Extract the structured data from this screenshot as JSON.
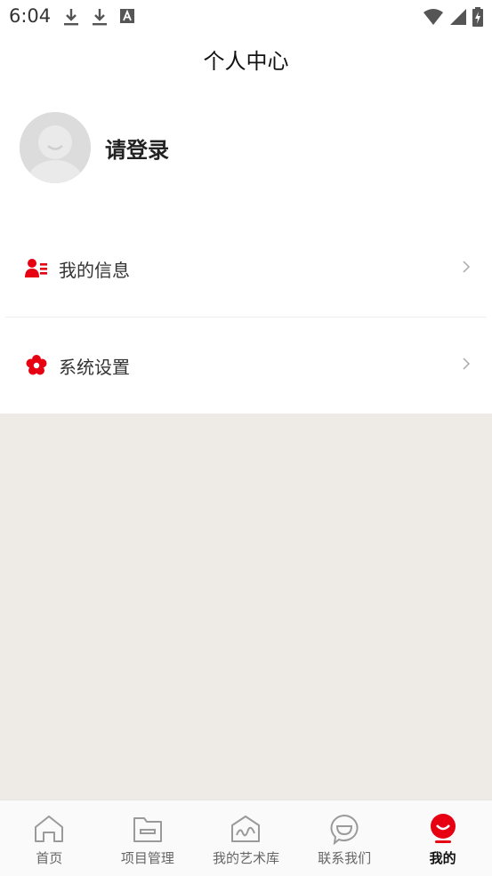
{
  "status_bar": {
    "time": "6:04"
  },
  "header": {
    "title": "个人中心"
  },
  "profile": {
    "login_label": "请登录"
  },
  "menu": {
    "items": [
      {
        "label": "我的信息",
        "icon": "user-info-icon"
      },
      {
        "label": "系统设置",
        "icon": "settings-flower-icon"
      }
    ]
  },
  "tabbar": {
    "active_index": 4,
    "items": [
      {
        "label": "首页",
        "icon": "home-icon"
      },
      {
        "label": "项目管理",
        "icon": "folder-icon"
      },
      {
        "label": "我的艺术库",
        "icon": "art-library-icon"
      },
      {
        "label": "联系我们",
        "icon": "chat-icon"
      },
      {
        "label": "我的",
        "icon": "profile-icon"
      }
    ]
  },
  "colors": {
    "accent": "#e60012",
    "gray_bg": "#eeebe6",
    "icon_gray": "#9a9a9a"
  }
}
